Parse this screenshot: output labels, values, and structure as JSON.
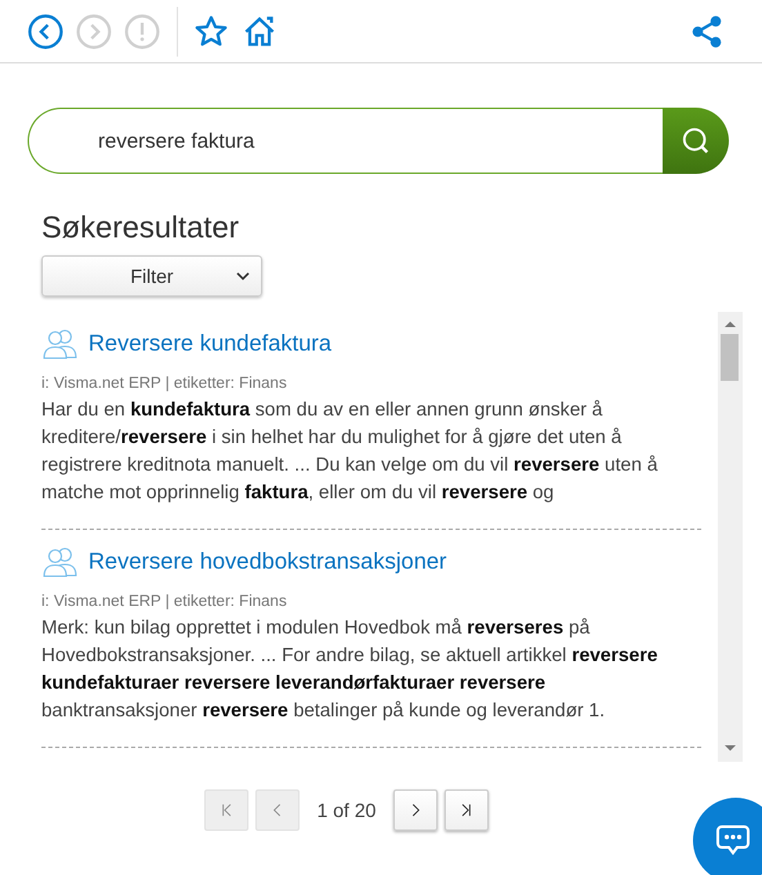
{
  "toolbar": {
    "nav_buttons": [
      {
        "kind": "back",
        "disabled": false
      },
      {
        "kind": "forward",
        "disabled": true
      },
      {
        "kind": "alert",
        "disabled": true
      }
    ],
    "actions": [
      {
        "kind": "favorite"
      },
      {
        "kind": "home"
      },
      {
        "kind": "share"
      }
    ]
  },
  "search": {
    "value": "reversere faktura"
  },
  "heading": "Søkeresultater",
  "filter": {
    "label": "Filter"
  },
  "results": [
    {
      "title": "Reversere kundefaktura",
      "meta": "i: Visma.net ERP | etiketter: Finans",
      "snippet": "Har du en **kundefaktura** som du av en eller annen grunn ønsker å kreditere/**reversere** i sin helhet har du mulighet for å gjøre det uten å registrere kreditnota manuelt.   ... Du kan velge om du vil **reversere** uten å matche mot opprinnelig **faktura**, eller om du vil **reversere** og"
    },
    {
      "title": "Reversere hovedbokstransaksjoner",
      "meta": "i: Visma.net ERP | etiketter: Finans",
      "snippet": "Merk: kun bilag opprettet i modulen Hovedbok må **reverseres** på Hovedbokstransaksjoner.  ... For andre bilag, se aktuell artikkel **reversere kundefakturaer reversere leverandørfakturaer reversere** banktransaksjoner **reversere** betalinger på kunde og leverandør   1."
    }
  ],
  "pager": {
    "buttons": [
      {
        "kind": "first",
        "disabled": true
      },
      {
        "kind": "prev",
        "disabled": true
      },
      {
        "kind": "next",
        "disabled": false
      },
      {
        "kind": "last",
        "disabled": false
      }
    ],
    "status": "1 of 20"
  }
}
